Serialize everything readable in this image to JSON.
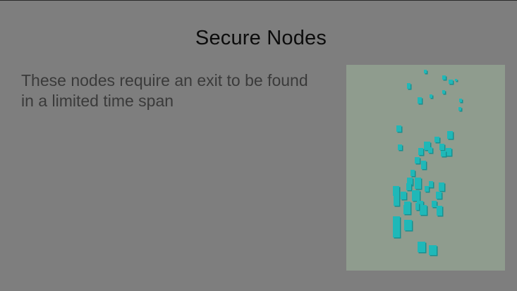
{
  "screen": {
    "title": "Secure Nodes",
    "description": "These nodes require an exit to be found in a limited time span"
  },
  "colors": {
    "background": "#7e7e7e",
    "preview_background": "#8f9c8e",
    "node_face": "#1fb8b8",
    "node_side": "#178f8f",
    "title_text": "#0c0c0c",
    "description_text": "#3a3a3a"
  },
  "preview": {
    "kind": "scene-preview",
    "node_shape": "cube"
  }
}
